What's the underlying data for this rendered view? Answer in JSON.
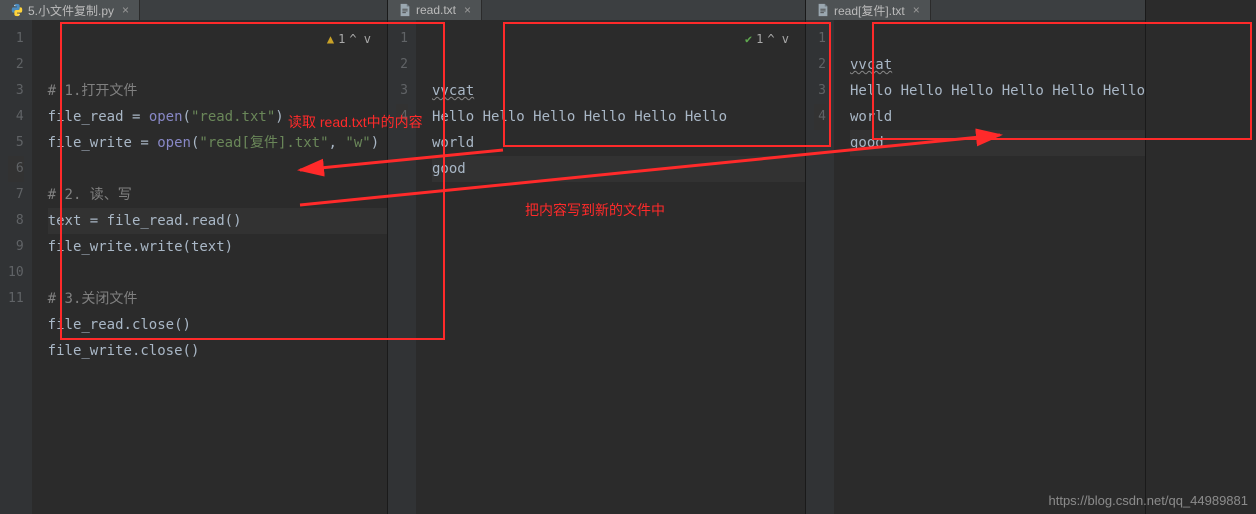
{
  "panes": [
    {
      "tab": {
        "icon": "python",
        "label": "5.小文件复制.py",
        "close": "×"
      },
      "status": {
        "icon": "warn",
        "count": "1",
        "arrows": "^ v"
      },
      "gutter": [
        "1",
        "2",
        "3",
        "4",
        "5",
        "6",
        "7",
        "8",
        "9",
        "10",
        "11"
      ],
      "lines": {
        "l1_cm": "# 1.打开文件",
        "l2_a": "file_read = ",
        "l2_fn": "open",
        "l2_b": "(",
        "l2_s": "\"read.txt\"",
        "l2_c": ")",
        "l3_a": "file_write = ",
        "l3_fn": "open",
        "l3_b": "(",
        "l3_s1": "\"read[复件].txt\"",
        "l3_mid": ", ",
        "l3_s2": "\"w\"",
        "l3_c": ")",
        "l4": "",
        "l5_cm": "# 2. 读、写",
        "l6": "text = file_read.read()",
        "l7": "file_write.write(text)",
        "l8": "",
        "l9_cm": "# 3.关闭文件",
        "l10": "file_read.close()",
        "l11": "file_write.close()"
      }
    },
    {
      "tab": {
        "icon": "text",
        "label": "read.txt",
        "close": "×"
      },
      "status": {
        "icon": "check",
        "count": "1",
        "arrows": "^ v"
      },
      "gutter": [
        "1",
        "2",
        "3",
        "4"
      ],
      "lines": {
        "l1": "vvcat",
        "l2": "Hello Hello Hello Hello Hello Hello",
        "l3": "world",
        "l4": "good"
      }
    },
    {
      "tab": {
        "icon": "text",
        "label": "read[复件].txt",
        "close": "×"
      },
      "gutter": [
        "1",
        "2",
        "3",
        "4"
      ],
      "lines": {
        "l1": "vvcat",
        "l2": "Hello Hello Hello Hello Hello Hello",
        "l3": "world",
        "l4": "good"
      }
    }
  ],
  "annotations": {
    "label1": "读取 read.txt中的内容",
    "label2": "把内容写到新的文件中"
  },
  "watermark": "https://blog.csdn.net/qq_44989881"
}
